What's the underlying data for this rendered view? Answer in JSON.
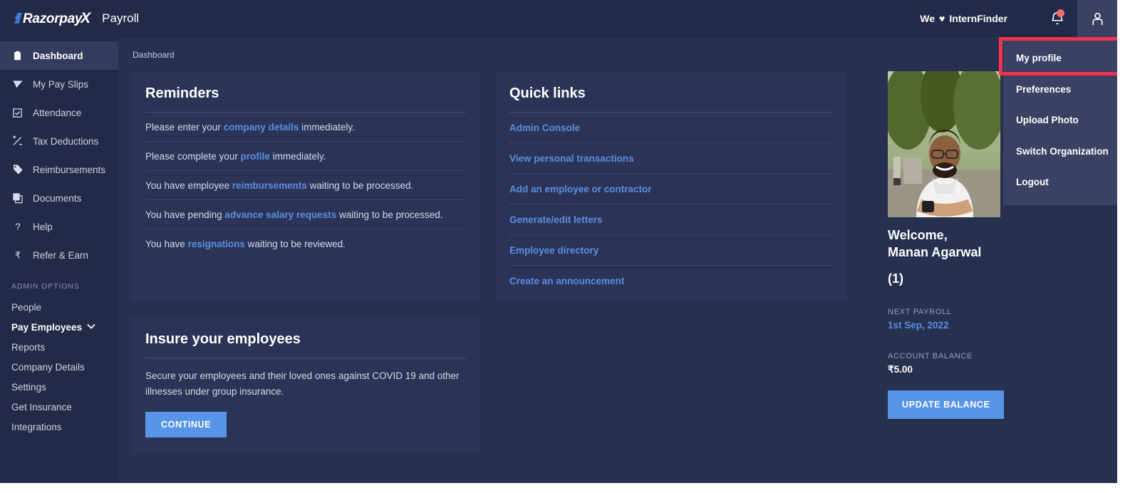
{
  "header": {
    "brand_razorpay": "Razorpay",
    "brand_x": "X",
    "brand_payroll": "Payroll",
    "tagline_pre": "We",
    "tagline_heart": "♥",
    "tagline_post": "InternFinder",
    "bell_icon": "notification-bell-icon",
    "user_icon": "user-avatar-icon"
  },
  "sidebar": {
    "items": [
      {
        "label": "Dashboard",
        "icon": "clipboard-icon",
        "active": true
      },
      {
        "label": "My Pay Slips",
        "icon": "paper-plane-icon",
        "active": false
      },
      {
        "label": "Attendance",
        "icon": "checkbox-calendar-icon",
        "active": false
      },
      {
        "label": "Tax Deductions",
        "icon": "plus-minus-icon",
        "active": false
      },
      {
        "label": "Reimbursements",
        "icon": "tag-icon",
        "active": false
      },
      {
        "label": "Documents",
        "icon": "documents-icon",
        "active": false
      },
      {
        "label": "Help",
        "icon": "question-mark-icon",
        "active": false
      },
      {
        "label": "Refer & Earn",
        "icon": "rupee-icon",
        "active": false
      }
    ],
    "admin_heading": "ADMIN OPTIONS",
    "admin_items": [
      {
        "label": "People",
        "bold": false,
        "chevron": false
      },
      {
        "label": "Pay Employees",
        "bold": true,
        "chevron": true
      },
      {
        "label": "Reports",
        "bold": false,
        "chevron": false
      },
      {
        "label": "Company Details",
        "bold": false,
        "chevron": false
      },
      {
        "label": "Settings",
        "bold": false,
        "chevron": false
      },
      {
        "label": "Get Insurance",
        "bold": false,
        "chevron": false
      },
      {
        "label": "Integrations",
        "bold": false,
        "chevron": false
      }
    ]
  },
  "main": {
    "breadcrumb": "Dashboard",
    "reminders": {
      "title": "Reminders",
      "rows": [
        {
          "pre": "Please enter your ",
          "link": "company details",
          "post": " immediately."
        },
        {
          "pre": "Please complete your ",
          "link": "profile",
          "post": " immediately."
        },
        {
          "pre": "You have employee ",
          "link": "reimbursements",
          "post": " waiting to be processed."
        },
        {
          "pre": "You have pending ",
          "link": "advance salary requests",
          "post": " waiting to be processed."
        },
        {
          "pre": "You have ",
          "link": "resignations",
          "post": " waiting to be reviewed."
        }
      ]
    },
    "quick_links": {
      "title": "Quick links",
      "items": [
        "Admin Console",
        "View personal transactions",
        "Add an employee or contractor",
        "Generate/edit letters",
        "Employee directory",
        "Create an announcement"
      ]
    },
    "insure": {
      "title": "Insure your employees",
      "body": "Secure your employees and their loved ones against COVID 19 and other illnesses under group insurance.",
      "button": "CONTINUE"
    }
  },
  "right_panel": {
    "avatar_alt": "profile-photo",
    "welcome_line1": "Welcome,",
    "welcome_line2": "Manan Agarwal",
    "welcome_count": "(1)",
    "next_payroll_label": "NEXT PAYROLL",
    "next_payroll_value": "1st Sep, 2022",
    "account_balance_label": "ACCOUNT BALANCE",
    "account_balance_value": "₹5.00",
    "update_balance_button": "UPDATE BALANCE"
  },
  "dropdown": {
    "items": [
      "My profile",
      "Preferences",
      "Upload Photo",
      "Switch Organization",
      "Logout"
    ]
  },
  "colors": {
    "page_bg": "#26304f",
    "chrome_bg": "#232a47",
    "card_bg": "#2b3456",
    "accent_blue": "#5895e8",
    "link_blue": "#5b8fe0",
    "highlight_red": "#f5334f",
    "menu_bg": "#3a4163"
  }
}
